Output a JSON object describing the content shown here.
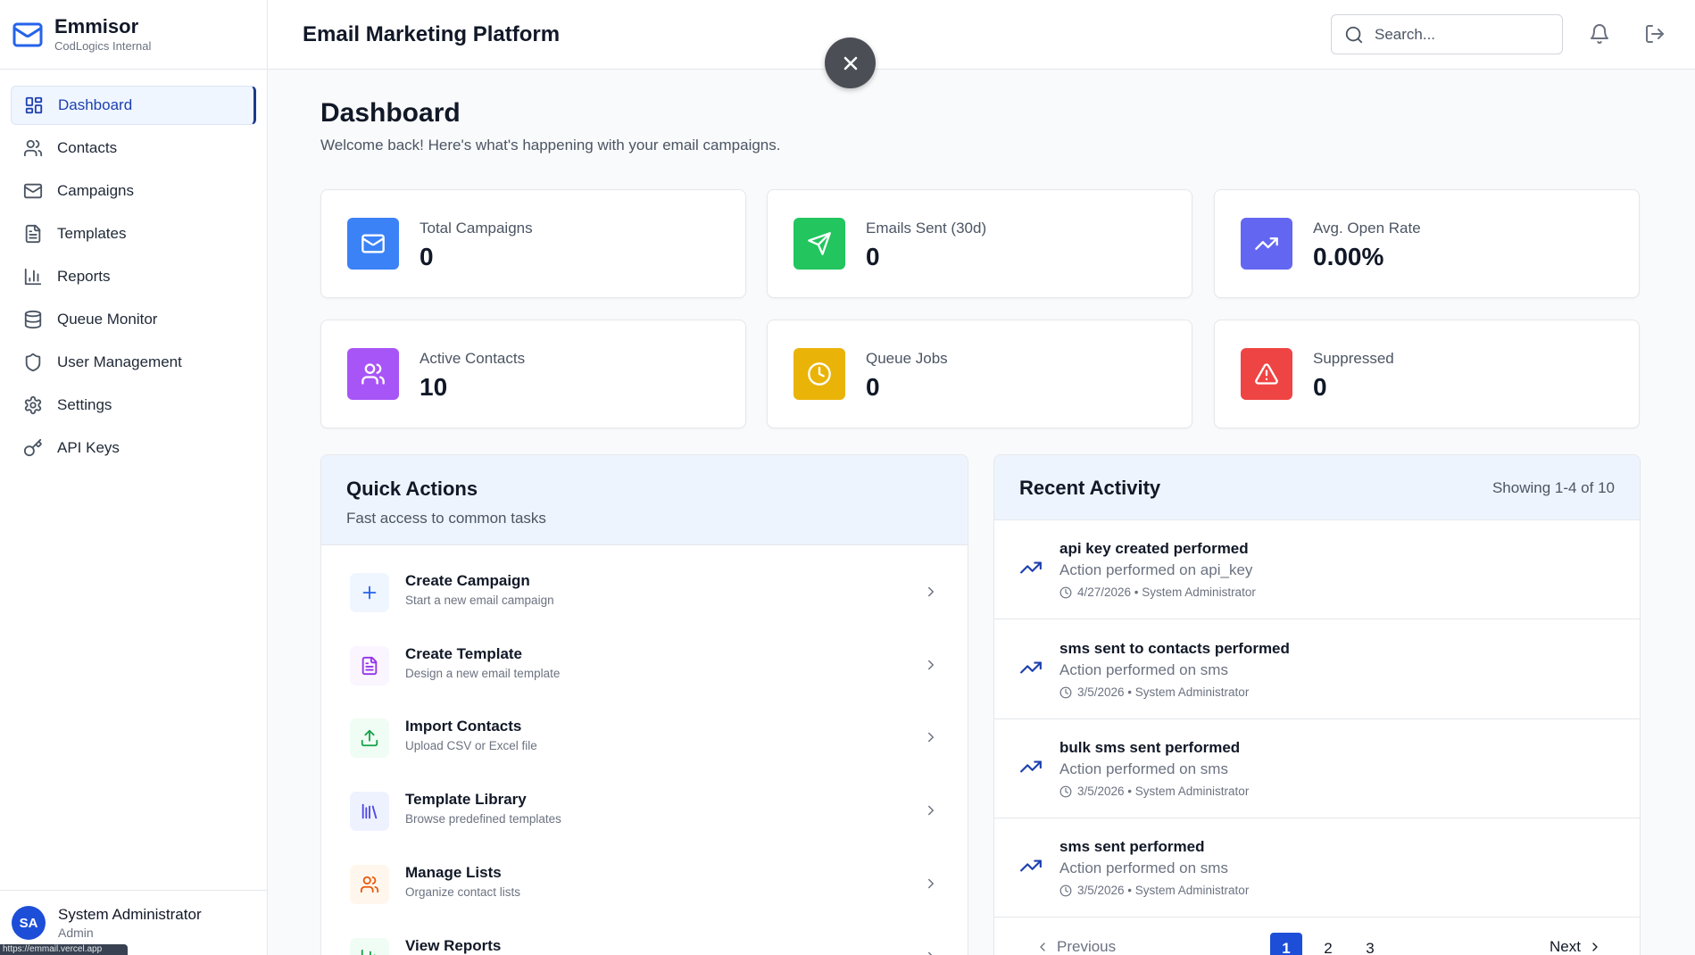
{
  "brand": {
    "name": "Emmisor",
    "subtitle": "CodLogics Internal"
  },
  "sidebar": {
    "items": [
      {
        "label": "Dashboard",
        "icon": "dashboard-grid-icon",
        "active": true
      },
      {
        "label": "Contacts",
        "icon": "users-icon"
      },
      {
        "label": "Campaigns",
        "icon": "mail-icon"
      },
      {
        "label": "Templates",
        "icon": "file-text-icon"
      },
      {
        "label": "Reports",
        "icon": "bar-chart-icon"
      },
      {
        "label": "Queue Monitor",
        "icon": "database-icon"
      },
      {
        "label": "User Management",
        "icon": "shield-icon"
      },
      {
        "label": "Settings",
        "icon": "gear-icon"
      },
      {
        "label": "API Keys",
        "icon": "key-icon"
      }
    ]
  },
  "user": {
    "initials": "SA",
    "name": "System Administrator",
    "role": "Admin"
  },
  "status_url": "https://emmail.vercel.app",
  "header": {
    "title": "Email Marketing Platform",
    "search_placeholder": "Search..."
  },
  "page": {
    "title": "Dashboard",
    "subtitle": "Welcome back! Here's what's happening with your email campaigns."
  },
  "stats": [
    {
      "label": "Total Campaigns",
      "value": "0",
      "color": "#3b82f6",
      "icon": "mail-icon"
    },
    {
      "label": "Emails Sent (30d)",
      "value": "0",
      "color": "#22c55e",
      "icon": "send-icon"
    },
    {
      "label": "Avg. Open Rate",
      "value": "0.00%",
      "color": "#6366f1",
      "icon": "trending-up-icon"
    },
    {
      "label": "Active Contacts",
      "value": "10",
      "color": "#a855f7",
      "icon": "users-icon"
    },
    {
      "label": "Queue Jobs",
      "value": "0",
      "color": "#eab308",
      "icon": "clock-icon"
    },
    {
      "label": "Suppressed",
      "value": "0",
      "color": "#ef4444",
      "icon": "alert-triangle-icon"
    }
  ],
  "quick_actions": {
    "title": "Quick Actions",
    "subtitle": "Fast access to common tasks",
    "items": [
      {
        "title": "Create Campaign",
        "desc": "Start a new email campaign",
        "icon": "plus-icon",
        "color": "#2563eb",
        "bg": "#eff6ff"
      },
      {
        "title": "Create Template",
        "desc": "Design a new email template",
        "icon": "file-text-icon",
        "color": "#9333ea",
        "bg": "#faf5ff"
      },
      {
        "title": "Import Contacts",
        "desc": "Upload CSV or Excel file",
        "icon": "upload-icon",
        "color": "#16a34a",
        "bg": "#f0fdf4"
      },
      {
        "title": "Template Library",
        "desc": "Browse predefined templates",
        "icon": "library-icon",
        "color": "#4f46e5",
        "bg": "#eef2ff"
      },
      {
        "title": "Manage Lists",
        "desc": "Organize contact lists",
        "icon": "users-icon",
        "color": "#ea580c",
        "bg": "#fff7ed"
      },
      {
        "title": "View Reports",
        "desc": "",
        "icon": "bar-chart-icon",
        "color": "#16a34a",
        "bg": "#f0fdf4"
      }
    ]
  },
  "recent_activity": {
    "title": "Recent Activity",
    "showing": "Showing 1-4 of 10",
    "items": [
      {
        "title": "api key created performed",
        "desc": "Action performed on api_key",
        "meta": "4/27/2026 • System Administrator"
      },
      {
        "title": "sms sent to contacts performed",
        "desc": "Action performed on sms",
        "meta": "3/5/2026 • System Administrator"
      },
      {
        "title": "bulk sms sent performed",
        "desc": "Action performed on sms",
        "meta": "3/5/2026 • System Administrator"
      },
      {
        "title": "sms sent performed",
        "desc": "Action performed on sms",
        "meta": "3/5/2026 • System Administrator"
      }
    ],
    "pagination": {
      "prev": "Previous",
      "next": "Next",
      "pages": [
        "1",
        "2",
        "3"
      ],
      "current": "1"
    }
  }
}
